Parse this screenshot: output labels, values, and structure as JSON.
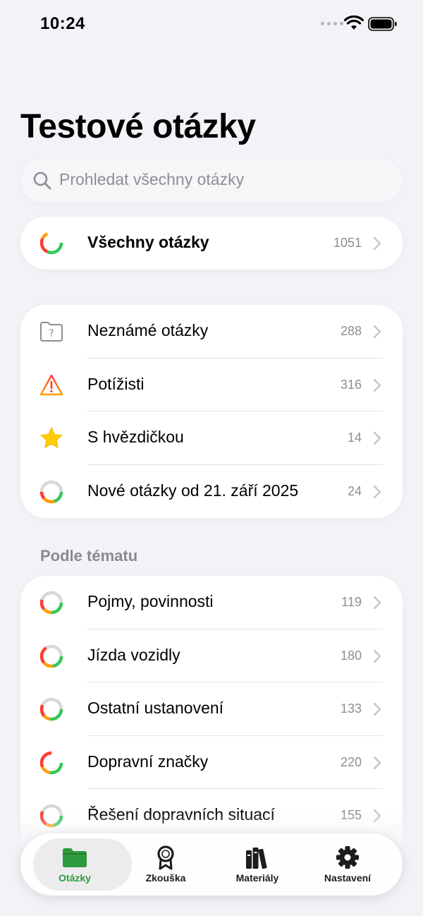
{
  "status_bar": {
    "time": "10:24"
  },
  "page_title": "Testové otázky",
  "search": {
    "placeholder": "Prohledat všechny otázky"
  },
  "all_questions": {
    "label": "Všechny otázky",
    "count": "1051"
  },
  "quick_lists": [
    {
      "label": "Neznámé otázky",
      "count": "288",
      "icon": "unknown-folder-icon"
    },
    {
      "label": "Potížisti",
      "count": "316",
      "icon": "warning-icon"
    },
    {
      "label": "S hvězdičkou",
      "count": "14",
      "icon": "star-icon"
    },
    {
      "label": "Nové otázky od 21. září 2025",
      "count": "24",
      "icon": "progress-ring-icon"
    }
  ],
  "topics_section": {
    "header": "Podle tématu",
    "items": [
      {
        "label": "Pojmy, povinnosti",
        "count": "119"
      },
      {
        "label": "Jízda vozidly",
        "count": "180"
      },
      {
        "label": "Ostatní ustanovení",
        "count": "133"
      },
      {
        "label": "Dopravní značky",
        "count": "220"
      },
      {
        "label": "Řešení dopravních situací",
        "count": "155"
      }
    ]
  },
  "tab_bar": {
    "tabs": [
      {
        "label": "Otázky",
        "icon": "folder-icon",
        "active": true
      },
      {
        "label": "Zkouška",
        "icon": "award-icon",
        "active": false
      },
      {
        "label": "Materiály",
        "icon": "books-icon",
        "active": false
      },
      {
        "label": "Nastavení",
        "icon": "gear-icon",
        "active": false
      }
    ]
  },
  "colors": {
    "accent_green": "#2e9a3e",
    "ring_green": "#34c759",
    "ring_red": "#ff3b30",
    "ring_orange": "#ff9f0a",
    "background": "#f2f2f7"
  }
}
